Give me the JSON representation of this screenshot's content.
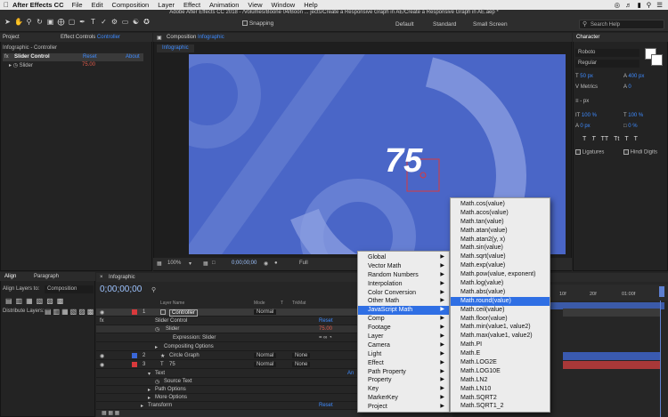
{
  "menubar": {
    "app": "After Effects CC",
    "items": [
      "File",
      "Edit",
      "Composition",
      "Layer",
      "Effect",
      "Animation",
      "View",
      "Window",
      "Help"
    ]
  },
  "window_title": "Adobe After Effects CC 2018 - /Volumes/Boone 04/Boon ... jects/Create a Responsive Graph in AE/Create a Responsive Graph in AE.aep *",
  "toolbar": {
    "snapping": "Snapping",
    "workspaces": [
      "Default",
      "Standard",
      "Small Screen"
    ],
    "search_placeholder": "Search Help"
  },
  "project_panel": {
    "tab_project": "Project",
    "tab_effect_controls": "Effect Controls",
    "tab_effect_target": "Controller",
    "subtitle": "Infographic - Controller",
    "effect_name": "Slider Control",
    "reset": "Reset",
    "about": "About",
    "slider_label": "Slider",
    "slider_value": "75.00"
  },
  "composition_panel": {
    "tab_label": "Composition",
    "tab_comp_name": "Infographic",
    "breadcrumb": "Infographic",
    "big_value": "75",
    "zoom": "100%",
    "timecode": "0;00;00;00",
    "resolution": "Full"
  },
  "character_panel": {
    "title": "Character",
    "font": "Roboto",
    "style": "Regular",
    "size": "50 px",
    "leading": "400 px",
    "kerning": "Metrics",
    "tracking": "0",
    "stroke": "- px",
    "vscale": "100 %",
    "hscale": "100 %",
    "baseline": "0 px",
    "tsume": "0 %",
    "ligatures": "Ligatures",
    "hindi": "Hindi Digits",
    "style_buttons": [
      "T",
      "T",
      "TT",
      "Tt",
      "T",
      "T"
    ]
  },
  "align_panel": {
    "tab_align": "Align",
    "tab_paragraph": "Paragraph",
    "align_layers_to_label": "Align Layers to:",
    "align_layers_to_value": "Composition",
    "distribute_label": "Distribute Layers:"
  },
  "timeline": {
    "tab": "Infographic",
    "timecode": "0;00;00;00",
    "col_layer_name": "Layer Name",
    "col_mode": "Mode",
    "col_t": "T",
    "col_trkmat": "TrkMat",
    "ruler_marks": [
      "10f",
      "20f",
      "01:00f"
    ],
    "rows": [
      {
        "num": "1",
        "name": "Controller",
        "mode": "Normal",
        "trkmat": "",
        "indent": 0
      },
      {
        "num": "",
        "name": "Slider Control",
        "mode": "",
        "value": "Reset",
        "indent": 1
      },
      {
        "num": "",
        "name": "Slider",
        "mode": "",
        "value": "75.00",
        "indent": 2
      },
      {
        "num": "",
        "name": "Expression: Slider",
        "mode": "",
        "indent": 3
      },
      {
        "num": "",
        "name": "Compositing Options",
        "mode": "",
        "indent": 2
      },
      {
        "num": "2",
        "name": "Circle Graph",
        "mode": "Normal",
        "trkmat": "None",
        "indent": 0
      },
      {
        "num": "3",
        "name": "75",
        "mode": "Normal",
        "trkmat": "None",
        "indent": 0
      },
      {
        "num": "",
        "name": "Text",
        "mode": "",
        "value": "An",
        "indent": 1
      },
      {
        "num": "",
        "name": "Source Text",
        "mode": "",
        "indent": 2
      },
      {
        "num": "",
        "name": "Path Options",
        "mode": "",
        "indent": 2
      },
      {
        "num": "",
        "name": "More Options",
        "mode": "",
        "indent": 2
      },
      {
        "num": "",
        "name": "Transform",
        "mode": "",
        "value": "Reset",
        "indent": 1
      }
    ]
  },
  "menu_left": {
    "items": [
      {
        "label": "Global",
        "sub": true
      },
      {
        "label": "Vector Math",
        "sub": true
      },
      {
        "label": "Random Numbers",
        "sub": true
      },
      {
        "label": "Interpolation",
        "sub": true
      },
      {
        "label": "Color Conversion",
        "sub": true
      },
      {
        "label": "Other Math",
        "sub": true
      },
      {
        "label": "JavaScript Math",
        "sub": true,
        "selected": true
      },
      {
        "label": "Comp",
        "sub": true
      },
      {
        "label": "Footage",
        "sub": true
      },
      {
        "label": "Layer",
        "sub": true
      },
      {
        "label": "Camera",
        "sub": true
      },
      {
        "label": "Light",
        "sub": true
      },
      {
        "label": "Effect",
        "sub": true
      },
      {
        "label": "Path Property",
        "sub": true
      },
      {
        "label": "Property",
        "sub": true
      },
      {
        "label": "Key",
        "sub": true
      },
      {
        "label": "MarkerKey",
        "sub": true
      },
      {
        "label": "Project",
        "sub": true
      }
    ]
  },
  "menu_right": {
    "items": [
      {
        "label": "Math.cos(value)"
      },
      {
        "label": "Math.acos(value)"
      },
      {
        "label": "Math.tan(value)"
      },
      {
        "label": "Math.atan(value)"
      },
      {
        "label": "Math.atan2(y, x)"
      },
      {
        "label": "Math.sin(value)"
      },
      {
        "label": "Math.sqrt(value)"
      },
      {
        "label": "Math.exp(value)"
      },
      {
        "label": "Math.pow(value, exponent)"
      },
      {
        "label": "Math.log(value)"
      },
      {
        "label": "Math.abs(value)"
      },
      {
        "label": "Math.round(value)",
        "selected": true
      },
      {
        "label": "Math.ceil(value)"
      },
      {
        "label": "Math.floor(value)"
      },
      {
        "label": "Math.min(value1, value2)"
      },
      {
        "label": "Math.max(value1, value2)"
      },
      {
        "label": "Math.PI"
      },
      {
        "label": "Math.E"
      },
      {
        "label": "Math.LOG2E"
      },
      {
        "label": "Math.LOG10E"
      },
      {
        "label": "Math.LN2"
      },
      {
        "label": "Math.LN10"
      },
      {
        "label": "Math.SQRT2"
      },
      {
        "label": "Math.SQRT1_2"
      }
    ]
  },
  "colors": {
    "comp_bg": "#4a66c7",
    "menu_highlight": "#2f6fe4",
    "label_red": "#d9393c",
    "label_blue": "#3a67d8",
    "track_blue": "#3a5ab0",
    "track_red": "#a83838"
  }
}
